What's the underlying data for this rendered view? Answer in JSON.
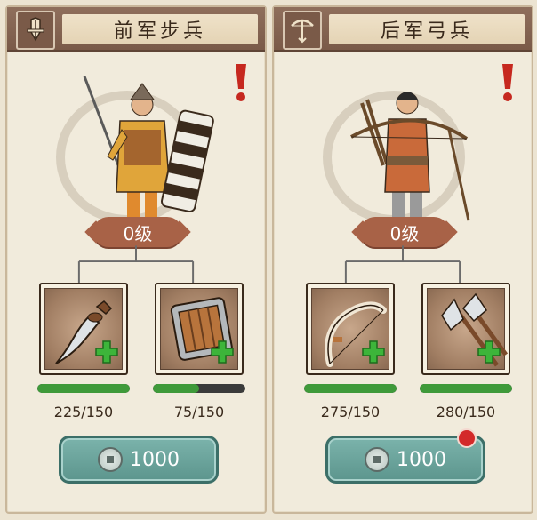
{
  "panels": {
    "left": {
      "title": "前军步兵",
      "icon": "sword-icon",
      "level": "0级",
      "items": [
        {
          "icon": "saber-icon",
          "count": "225/150",
          "progress": 1.0
        },
        {
          "icon": "shield-icon",
          "count": "75/150",
          "progress": 0.5
        }
      ],
      "cost": "1000",
      "has_red_dot": false
    },
    "right": {
      "title": "后军弓兵",
      "icon": "bow-icon",
      "level": "0级",
      "items": [
        {
          "icon": "bow-item-icon",
          "count": "275/150",
          "progress": 1.0
        },
        {
          "icon": "axe-icon",
          "count": "280/150",
          "progress": 1.0
        }
      ],
      "cost": "1000",
      "has_red_dot": true
    }
  },
  "colors": {
    "accent_green": "#3f9a3a",
    "header_brown": "#7a5a48",
    "level_badge": "#a86247",
    "button_teal": "#5c958d",
    "alert_red": "#d32a2a"
  }
}
